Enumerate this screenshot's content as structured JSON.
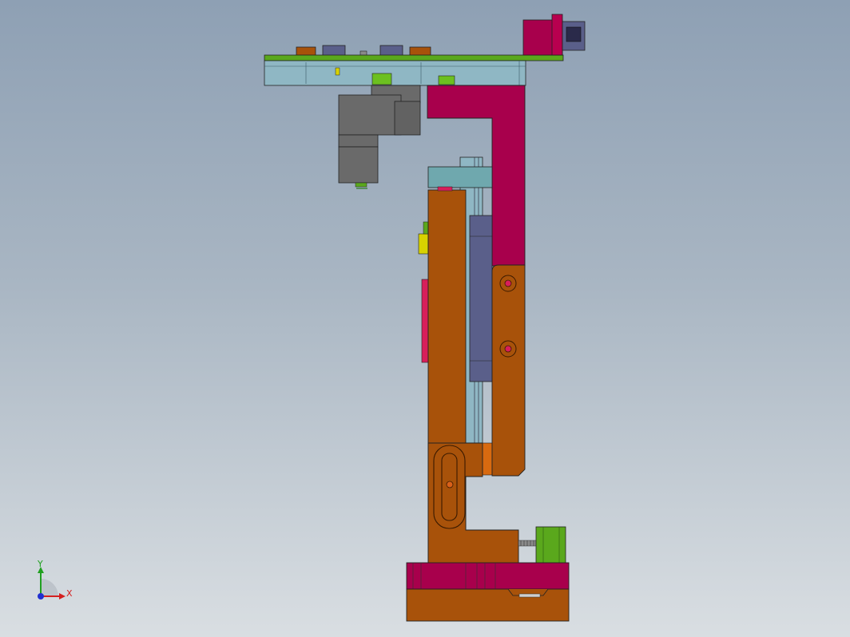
{
  "viewport": {
    "background_top": "#8ea0b4",
    "background_bottom": "#d9dee2"
  },
  "colors": {
    "magenta": "#a8004c",
    "orange_brown": "#a8520a",
    "green": "#5aa81c",
    "light_blue": "#8fb7c4",
    "teal": "#6fa8ae",
    "dark_gray": "#6a6a6a",
    "slate_blue": "#5a5f8a",
    "yellow": "#d8d200",
    "pink_red": "#d81e5a"
  },
  "triad": {
    "x_label": "X",
    "y_label": "Y",
    "x_color": "#d42020",
    "y_color": "#20a020",
    "z_color": "#2030d0"
  },
  "assembly": {
    "parts": [
      "top-mounting-plate",
      "gripper-cylinder-body",
      "upper-l-bracket",
      "vertical-slide-column",
      "linear-guide-rail",
      "lower-slotted-bracket",
      "base-block",
      "stop-cylinder",
      "motor-block"
    ]
  }
}
